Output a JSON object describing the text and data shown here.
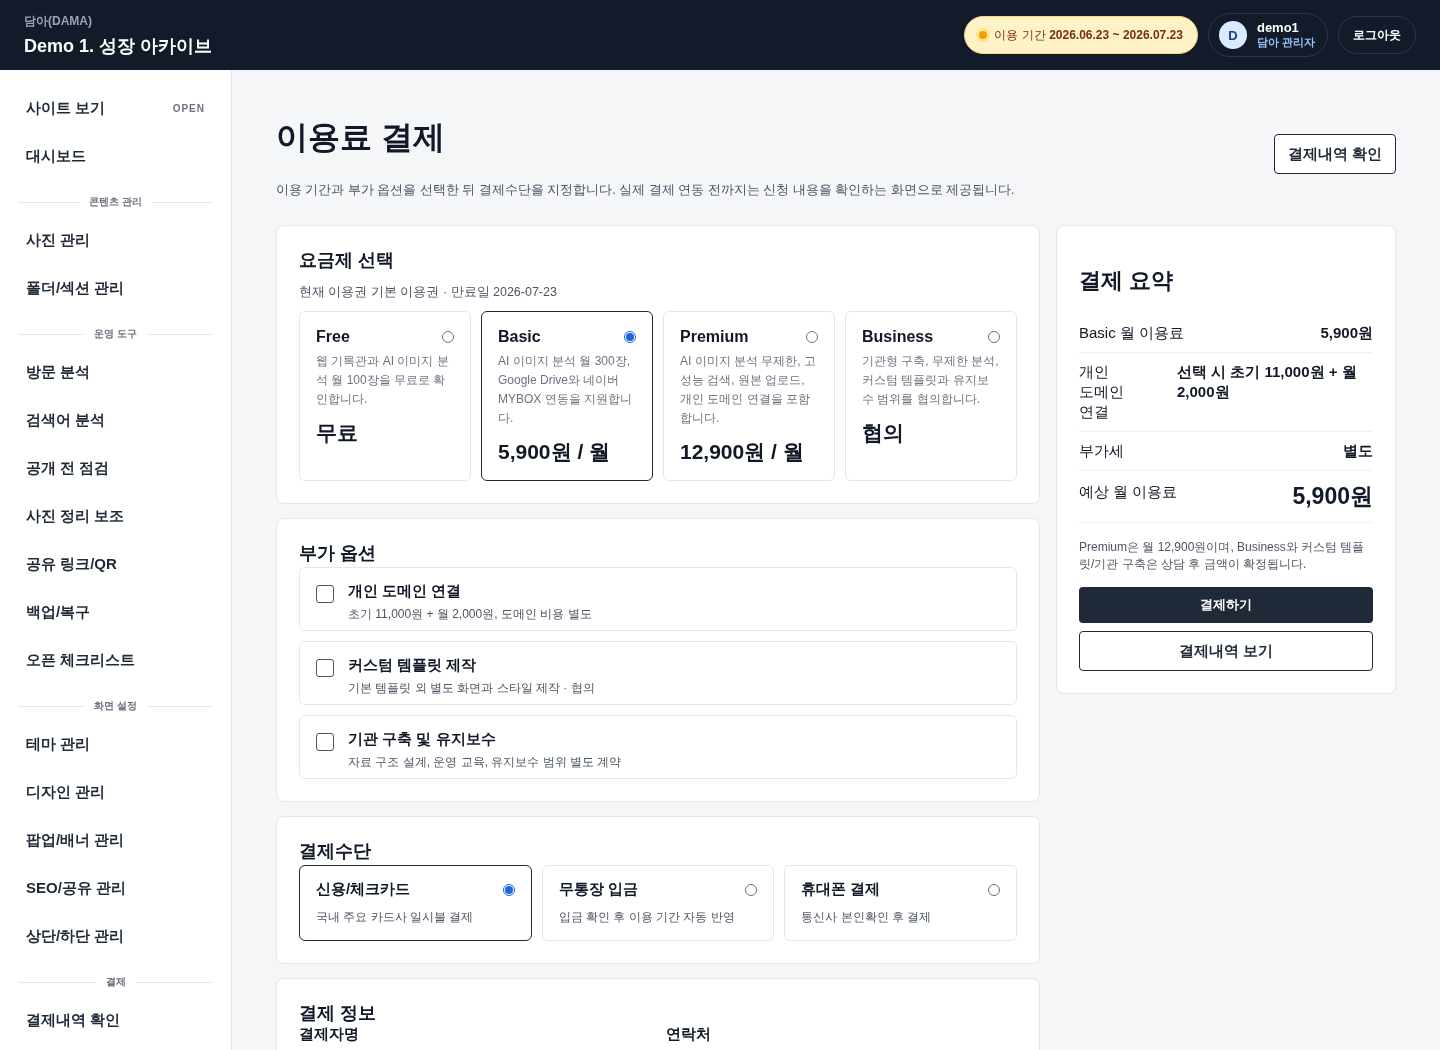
{
  "header": {
    "brand": "담아(DAMA)",
    "title": "Demo 1. 성장 아카이브",
    "period": "이용 기간 **2026.06.23 ~ 2026.07.23**",
    "user": {
      "initial": "D",
      "name": "demo1",
      "role": "담아 관리자"
    },
    "logout": "로그아웃"
  },
  "sidebar": {
    "items": [
      {
        "kind": "link",
        "label": "사이트 보기",
        "badge": "OPEN"
      },
      {
        "kind": "link",
        "label": "대시보드"
      },
      {
        "kind": "section",
        "label": "콘텐츠 관리"
      },
      {
        "kind": "link",
        "label": "사진 관리"
      },
      {
        "kind": "link",
        "label": "폴더/섹션 관리"
      },
      {
        "kind": "section",
        "label": "운영 도구"
      },
      {
        "kind": "link",
        "label": "방문 분석"
      },
      {
        "kind": "link",
        "label": "검색어 분석"
      },
      {
        "kind": "link",
        "label": "공개 전 점검"
      },
      {
        "kind": "link",
        "label": "사진 정리 보조"
      },
      {
        "kind": "link",
        "label": "공유 링크/QR"
      },
      {
        "kind": "link",
        "label": "백업/복구"
      },
      {
        "kind": "link",
        "label": "오픈 체크리스트"
      },
      {
        "kind": "section",
        "label": "화면 설정"
      },
      {
        "kind": "link",
        "label": "테마 관리"
      },
      {
        "kind": "link",
        "label": "디자인 관리"
      },
      {
        "kind": "link",
        "label": "팝업/배너 관리"
      },
      {
        "kind": "link",
        "label": "SEO/공유 관리"
      },
      {
        "kind": "link",
        "label": "상단/하단 관리"
      },
      {
        "kind": "section",
        "label": "결제"
      },
      {
        "kind": "link",
        "label": "결제내역 확인"
      }
    ]
  },
  "page": {
    "title": "이용료 결제",
    "description": "이용 기간과 부가 옵션을 선택한 뒤 결제수단을 지정합니다. 실제 결제 연동 전까지는 신청 내용을 확인하는 화면으로 제공됩니다.",
    "history_button": "결제내역 확인"
  },
  "plans": {
    "title": "요금제 선택",
    "subtitle": "현재 이용권 기본 이용권 · 만료일 2026-07-23",
    "items": [
      {
        "name": "Free",
        "description": "웹 기록관과 AI 이미지 분석 월 100장을 무료로 확인합니다.",
        "price": "무료",
        "selected": false
      },
      {
        "name": "Basic",
        "description": "AI 이미지 분석 월 300장, Google Drive와 네이버 MYBOX 연동을 지원합니다.",
        "price": "5,900원 / 월",
        "selected": true
      },
      {
        "name": "Premium",
        "description": "AI 이미지 분석 무제한, 고성능 검색, 원본 업로드, 개인 도메인 연결을 포함합니다.",
        "price": "12,900원 / 월",
        "selected": false
      },
      {
        "name": "Business",
        "description": "기관형 구축, 무제한 분석, 커스텀 템플릿과 유지보수 범위를 협의합니다.",
        "price": "협의",
        "selected": false
      }
    ]
  },
  "addons": {
    "title": "부가 옵션",
    "items": [
      {
        "name": "개인 도메인 연결",
        "detail": "초기 11,000원 + 월 2,000원, 도메인 비용 별도",
        "checked": false
      },
      {
        "name": "커스텀 템플릿 제작",
        "detail": "기본 템플릿 외 별도 화면과 스타일 제작 · 협의",
        "checked": false
      },
      {
        "name": "기관 구축 및 유지보수",
        "detail": "자료 구조 설계, 운영 교육, 유지보수 범위 별도 계약",
        "checked": false
      }
    ]
  },
  "methods": {
    "title": "결제수단",
    "items": [
      {
        "name": "신용/체크카드",
        "detail": "국내 주요 카드사 일시불 결제",
        "selected": true
      },
      {
        "name": "무통장 입금",
        "detail": "입금 확인 후 이용 기간 자동 반영",
        "selected": false
      },
      {
        "name": "휴대폰 결제",
        "detail": "통신사 본인확인 후 결제",
        "selected": false
      }
    ]
  },
  "payment_info": {
    "title": "결제 정보",
    "fields": [
      {
        "label": "결제자명"
      },
      {
        "label": "연락처"
      }
    ]
  },
  "summary": {
    "title": "결제 요약",
    "rows": [
      {
        "kind": "line",
        "label": "Basic 월 이용료",
        "value": "5,900원"
      },
      {
        "kind": "line",
        "label": "개인 도메인 연결",
        "value": "선택 시 초기 11,000원 + 월 2,000원"
      },
      {
        "kind": "line",
        "label": "부가세",
        "value": "별도"
      },
      {
        "kind": "total",
        "label": "예상 월 이용료",
        "value": "5,900원"
      }
    ],
    "note": "Premium은 월 12,900원이며, Business와 커스텀 템플릿/기관 구축은 상담 후 금액이 확정됩니다.",
    "pay_button": "결제하기",
    "history_button": "결제내역 보기"
  }
}
